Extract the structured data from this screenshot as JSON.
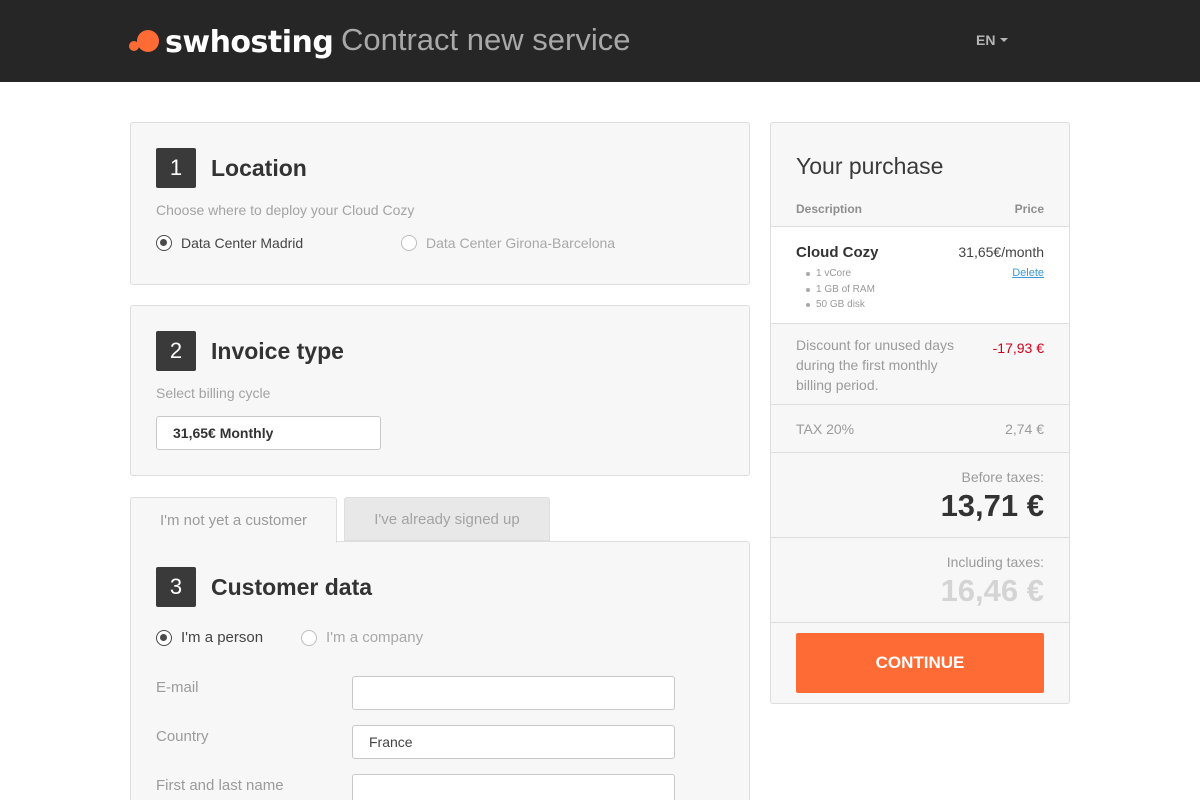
{
  "header": {
    "brand": "swhosting",
    "title": "Contract new service",
    "language": "EN",
    "colors": {
      "background": "#262626",
      "accent": "#ff6b35"
    }
  },
  "location": {
    "step": "1",
    "title": "Location",
    "hint": "Choose where to deploy your Cloud Cozy",
    "options": [
      {
        "label": "Data Center Madrid",
        "selected": true
      },
      {
        "label": "Data Center Girona-Barcelona",
        "selected": false
      }
    ]
  },
  "invoice": {
    "step": "2",
    "title": "Invoice type",
    "hint": "Select billing cycle",
    "selected_cycle": "31,65€ Monthly"
  },
  "customer": {
    "tabs": [
      {
        "label": "I'm not yet a customer",
        "active": true
      },
      {
        "label": "I've already signed up",
        "active": false
      }
    ],
    "step": "3",
    "title": "Customer data",
    "types": [
      {
        "label": "I'm a person",
        "selected": true
      },
      {
        "label": "I'm a company",
        "selected": false
      }
    ],
    "fields": {
      "email": {
        "label": "E-mail",
        "value": ""
      },
      "country": {
        "label": "Country",
        "value": "France"
      },
      "name": {
        "label": "First and last name",
        "value": ""
      }
    }
  },
  "purchase": {
    "title": "Your purchase",
    "col_description": "Description",
    "col_price": "Price",
    "product": {
      "name": "Cloud Cozy",
      "price": "31,65€/month",
      "delete_label": "Delete",
      "specs": [
        "1 vCore",
        "1 GB of RAM",
        "50 GB disk"
      ]
    },
    "discount": {
      "text": "Discount for unused days during the first monthly billing period.",
      "value": "-17,93 €"
    },
    "tax": {
      "label": "TAX 20%",
      "value": "2,74 €"
    },
    "before_taxes": {
      "label": "Before taxes:",
      "value": "13,71 €"
    },
    "including_taxes": {
      "label": "Including taxes:",
      "value": "16,46 €"
    },
    "continue_label": "CONTINUE",
    "colors": {
      "discount": "#d0021b",
      "button": "#ff6b35"
    }
  }
}
